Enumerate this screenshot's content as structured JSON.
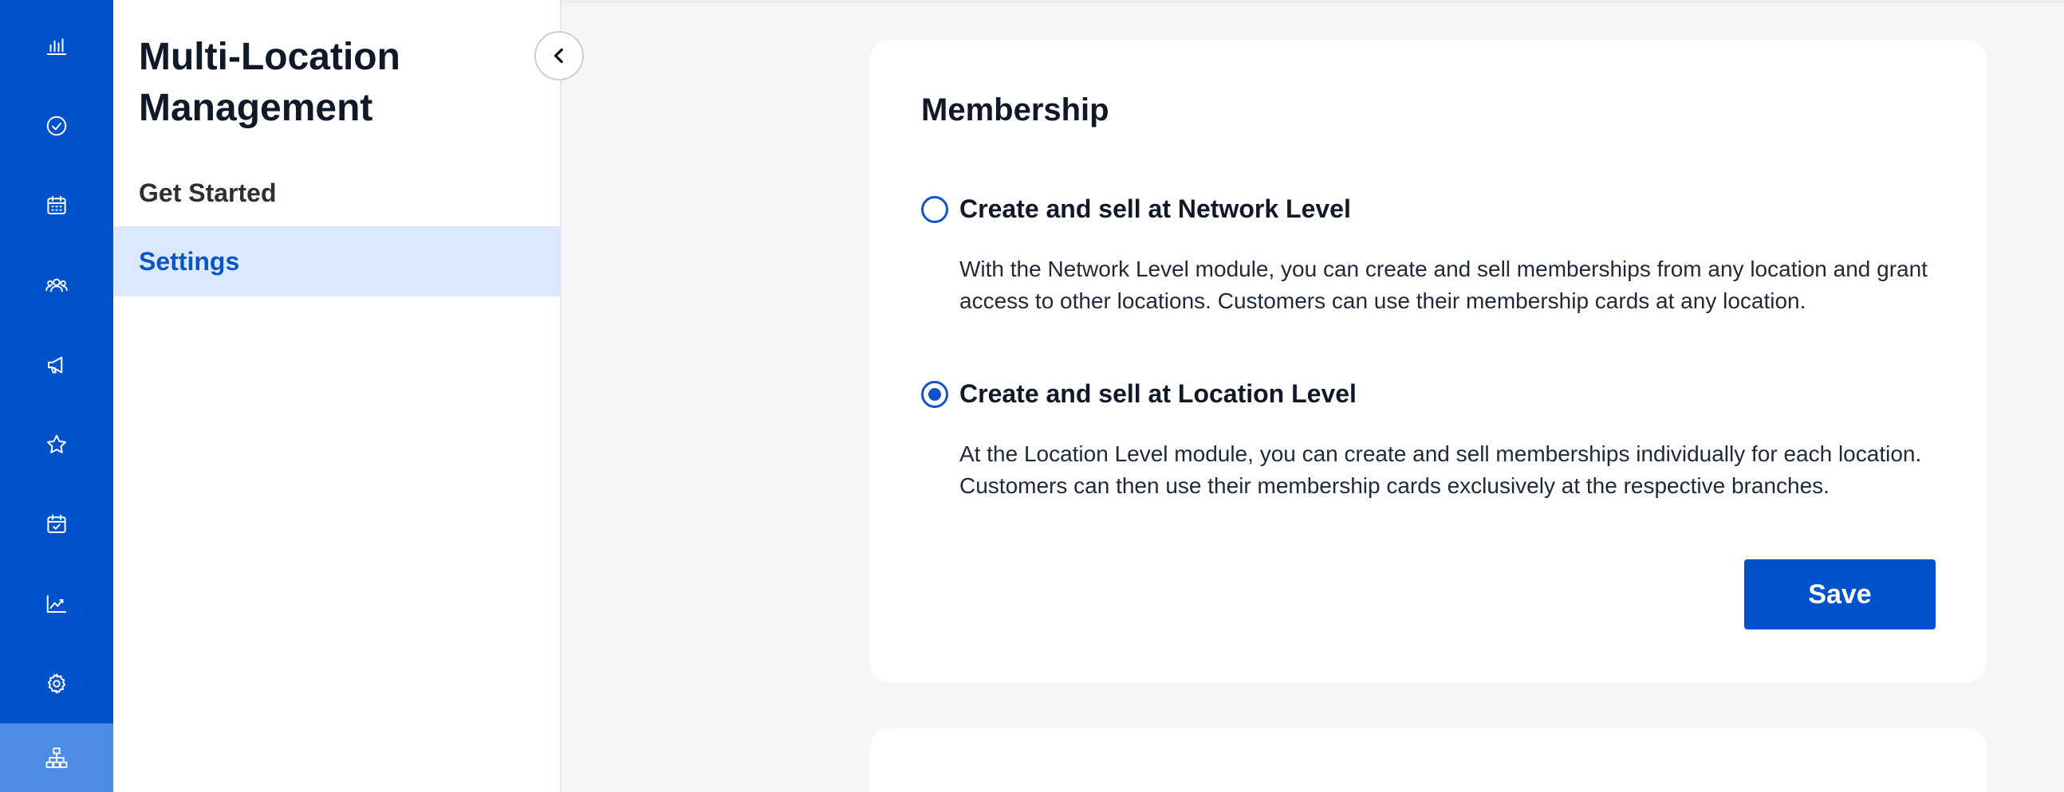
{
  "rail": {
    "items": [
      {
        "icon": "bar-chart-icon"
      },
      {
        "icon": "check-circle-icon"
      },
      {
        "icon": "calendar-icon"
      },
      {
        "icon": "users-icon"
      },
      {
        "icon": "megaphone-icon"
      },
      {
        "icon": "star-icon"
      },
      {
        "icon": "calendar-check-icon"
      },
      {
        "icon": "line-chart-icon"
      },
      {
        "icon": "gear-icon"
      },
      {
        "icon": "sitemap-icon",
        "active": true
      }
    ],
    "color": "#0052cc",
    "active_color": "#4c8ce6"
  },
  "subnav": {
    "title": "Multi-Location Management",
    "items": [
      {
        "label": "Get Started",
        "active": false
      },
      {
        "label": "Settings",
        "active": true
      }
    ],
    "collapse_icon": "chevron-left-icon"
  },
  "membership": {
    "title": "Membership",
    "options": [
      {
        "label": "Create and sell at Network Level",
        "description": "With the Network Level module, you can create and sell memberships from any location and grant access to other locations. Customers can use their membership cards at any location.",
        "checked": false
      },
      {
        "label": "Create and sell at Location Level",
        "description": "At the Location Level module, you can create and sell memberships individually for each location. Customers can then use their membership cards exclusively at the respective branches.",
        "checked": true
      }
    ],
    "save_label": "Save"
  },
  "colors": {
    "accent": "#0052cc",
    "selected_bg": "#dce9fc",
    "page_bg": "#f5f6f8"
  }
}
